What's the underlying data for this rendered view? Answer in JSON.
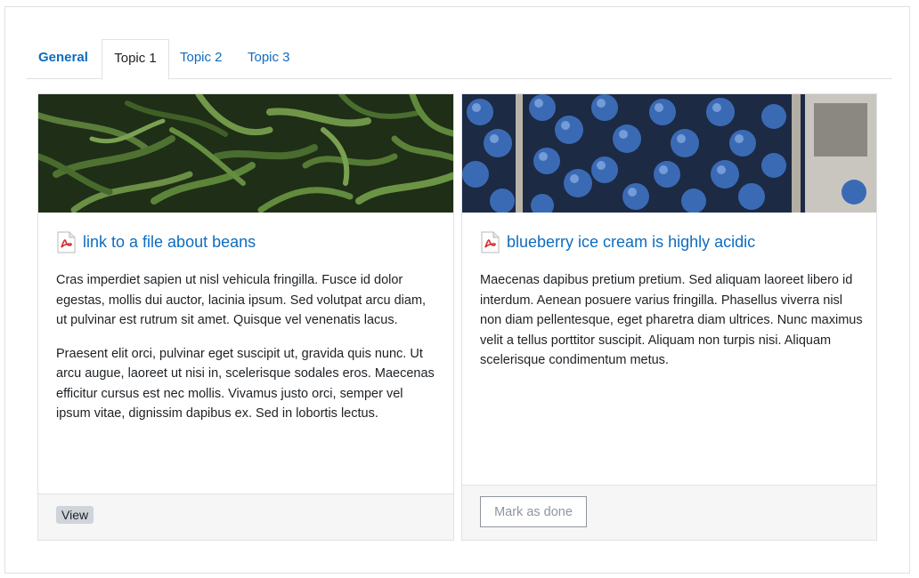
{
  "tabs": [
    {
      "label": "General"
    },
    {
      "label": "Topic 1"
    },
    {
      "label": "Topic 2"
    },
    {
      "label": "Topic 3"
    }
  ],
  "cards": [
    {
      "image_icon": "green-beans-photo",
      "file_icon": "pdf-icon",
      "title": "link to a file about beans",
      "paragraphs": [
        "Cras imperdiet sapien ut nisl vehicula fringilla. Fusce id dolor egestas, mollis dui auctor, lacinia ipsum. Sed volutpat arcu diam, ut pulvinar est rutrum sit amet. Quisque vel venenatis lacus.",
        "Praesent elit orci, pulvinar eget suscipit ut, gravida quis nunc. Ut arcu augue, laoreet ut nisi in, scelerisque sodales eros. Maecenas efficitur cursus est nec mollis. Vivamus justo orci, semper vel ipsum vitae, dignissim dapibus ex. Sed in lobortis lectus."
      ],
      "footer_label": "View"
    },
    {
      "image_icon": "blueberries-photo",
      "file_icon": "pdf-icon",
      "title": "blueberry ice cream is highly acidic",
      "paragraphs": [
        "Maecenas dapibus pretium pretium. Sed aliquam laoreet libero id interdum. Aenean posuere varius fringilla. Phasellus viverra nisl non diam pellentesque, eget pharetra diam ultrices. Nunc maximus velit a tellus porttitor suscipit. Aliquam non turpis nisi. Aliquam scelerisque condimentum metus."
      ],
      "footer_label": "Mark as done"
    }
  ],
  "colors": {
    "link": "#0f6cbf",
    "text": "#1d2125",
    "border": "#dee2e6",
    "footer_bg": "#f6f6f7"
  }
}
